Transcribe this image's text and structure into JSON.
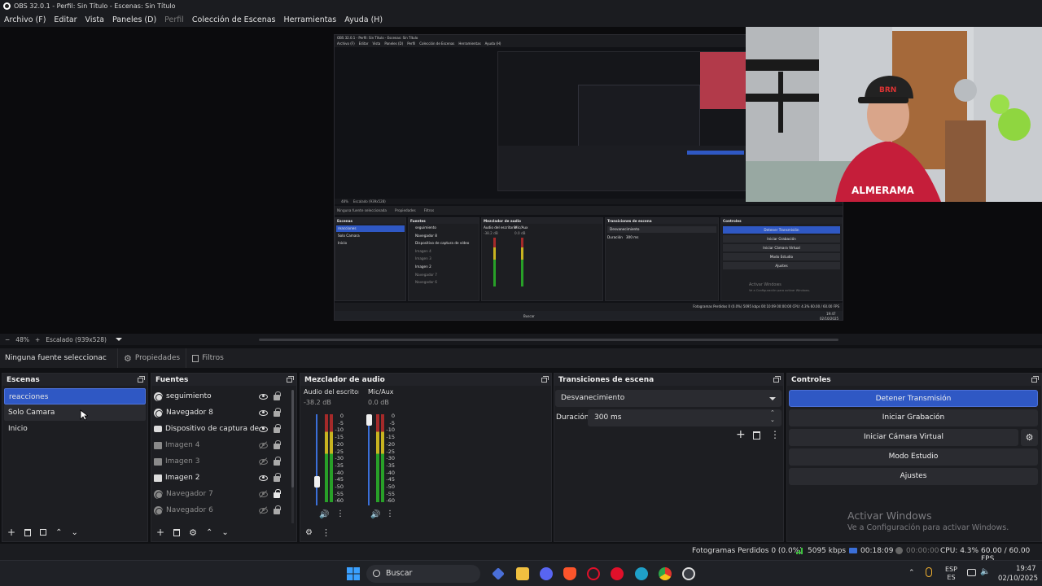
{
  "window": {
    "title": "OBS 32.0.1 - Perfil: Sin Título - Escenas: Sin Título"
  },
  "menu": [
    "Archivo (F)",
    "Editar",
    "Vista",
    "Paneles (D)",
    "Perfil",
    "Colección de Escenas",
    "Herramientas",
    "Ayuda (H)"
  ],
  "nested_preview": {
    "title": "OBS 32.0.1 - Perfil: Sin Título - Escenas: Sin Título",
    "menu": [
      "Archivo (F)",
      "Editar",
      "Vista",
      "Paneles (D)",
      "Perfil",
      "Colección de Escenas",
      "Herramientas",
      "Ayuda (H)"
    ],
    "zoom_label": "48%",
    "scale_label": "Escalado (939x528)",
    "context_none": "Ninguna fuente seleccionada",
    "context_props": "Propiedades",
    "context_filters": "Filtros",
    "docks": [
      "Escenas",
      "Fuentes",
      "Mezclador de audio",
      "Transiciones de escena",
      "Controles"
    ],
    "scenes": [
      "reacciones",
      "Solo Camara",
      "Inicio"
    ],
    "sources": [
      "seguimiento",
      "Navegador 8",
      "Dispositivo de captura de vídeo",
      "Imagen 4",
      "Imagen 3",
      "Imagen 2",
      "Navegador 7",
      "Navegador 6"
    ],
    "mixer_cols": [
      "Audio del escritorio",
      "Mic/Aux"
    ],
    "mixer_db": [
      "-38.2 dB",
      "0.0 dB"
    ],
    "transition": "Desvanecimiento",
    "duration_label": "Duración",
    "duration_value": "300 ms",
    "controls": [
      "Detener Transmisión",
      "Iniciar Grabación",
      "Iniciar Cámara Virtual",
      "Modo Estudio",
      "Ajustes"
    ],
    "watermark_title": "Activar Windows",
    "watermark_sub": "Ve a Configuración para activar Windows.",
    "status": "Fotogramas Perdidos 0 (0.0%)   5095 kbps   00:10:09   00:00:00   CPU: 4.3%   60.00 / 60.00 FPS",
    "taskbar_search": "Buscar",
    "clock_time": "19:47",
    "clock_date": "02/10/2025"
  },
  "zoom": {
    "minus": "−",
    "level": "48%",
    "plus": "+",
    "scaling": "Escalado (939x528)"
  },
  "context": {
    "none_selected": "Ninguna fuente seleccionac",
    "properties": "Propiedades",
    "filters": "Filtros"
  },
  "scenes_dock": {
    "title": "Escenas",
    "items": [
      "reacciones",
      "Solo Camara",
      "Inicio"
    ]
  },
  "sources_dock": {
    "title": "Fuentes",
    "items": [
      {
        "label": "seguimiento",
        "icon": "browser-icon",
        "visible": true,
        "locked": false
      },
      {
        "label": "Navegador 8",
        "icon": "browser-icon",
        "visible": true,
        "locked": false
      },
      {
        "label": "Dispositivo de captura de ví",
        "icon": "camera-icon",
        "visible": true,
        "locked": false
      },
      {
        "label": "Imagen 4",
        "icon": "image-icon",
        "visible": false,
        "locked": false
      },
      {
        "label": "Imagen 3",
        "icon": "image-icon",
        "visible": false,
        "locked": false
      },
      {
        "label": "Imagen 2",
        "icon": "image-icon",
        "visible": true,
        "locked": false
      },
      {
        "label": "Navegador 7",
        "icon": "browser-icon",
        "visible": false,
        "locked": true
      },
      {
        "label": "Navegador 6",
        "icon": "browser-icon",
        "visible": false,
        "locked": false
      }
    ]
  },
  "mixer_dock": {
    "title": "Mezclador de audio",
    "channels": [
      {
        "name": "Audio del escritoric",
        "db": "-38.2 dB",
        "fader_level": 0.22
      },
      {
        "name": "Mic/Aux",
        "db": "0.0 dB",
        "fader_level": 1.0
      }
    ],
    "ticks": [
      "0",
      "-5",
      "-10",
      "-15",
      "-20",
      "-25",
      "-30",
      "-35",
      "-40",
      "-45",
      "-50",
      "-55",
      "-60"
    ]
  },
  "transitions_dock": {
    "title": "Transiciones de escena",
    "selected": "Desvanecimiento",
    "duration_label": "Duración",
    "duration_value": "300 ms"
  },
  "controls_dock": {
    "title": "Controles",
    "stop_stream": "Detener Transmisión",
    "start_recording": "Iniciar Grabación",
    "start_virtual_cam": "Iniciar Cámara Virtual",
    "studio_mode": "Modo Estudio",
    "settings": "Ajustes"
  },
  "watermark": {
    "title": "Activar Windows",
    "subtitle": "Ve a Configuración para activar Windows."
  },
  "status": {
    "dropped_frames": "Fotogramas Perdidos 0 (0.0%)",
    "bitrate": "5095 kbps",
    "stream_time": "00:18:09",
    "rec_time": "00:00:00",
    "cpu": "CPU: 4.3%",
    "fps": "60.00 / 60.00 FPS"
  },
  "taskbar": {
    "search_placeholder": "Buscar",
    "lang_top": "ESP",
    "lang_bottom": "ES",
    "time": "19:47",
    "date": "02/10/2025"
  },
  "colors": {
    "accent": "#2f58c4",
    "dock_bg": "#1d1e22",
    "live_green": "#28a028"
  }
}
